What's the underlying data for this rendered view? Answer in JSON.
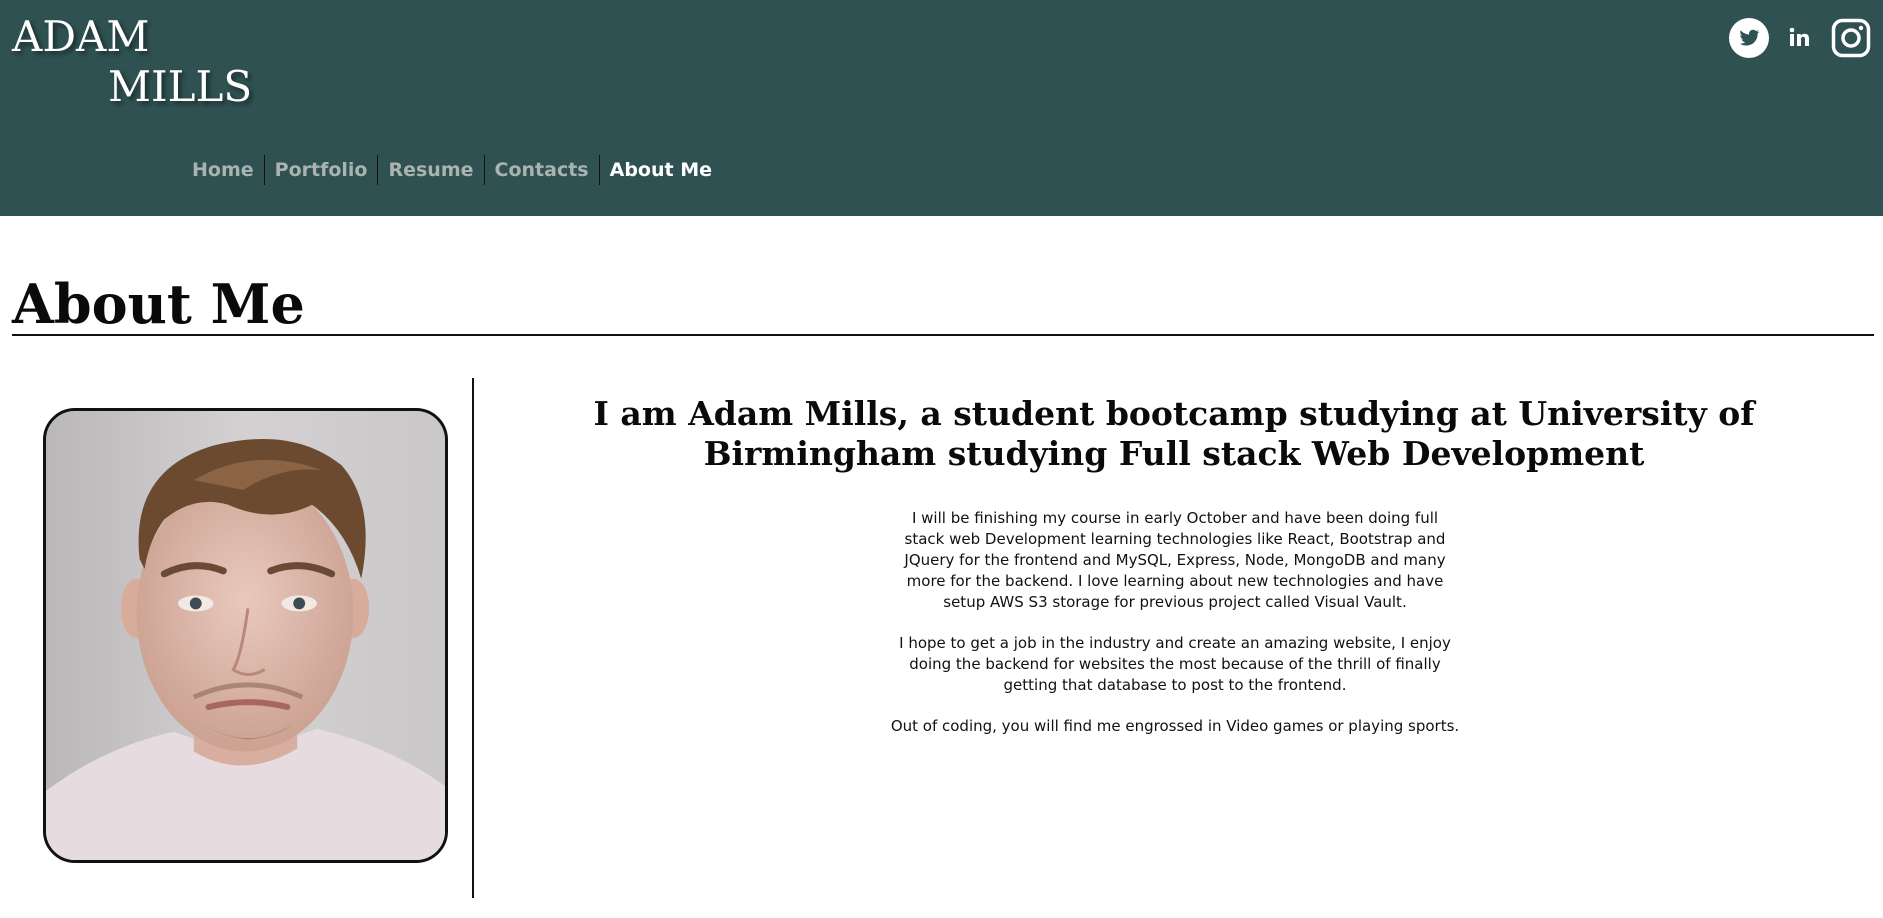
{
  "header": {
    "logo_line1": "ADAM",
    "logo_line2": "MILLS",
    "nav": [
      {
        "label": "Home",
        "active": false
      },
      {
        "label": "Portfolio",
        "active": false
      },
      {
        "label": "Resume",
        "active": false
      },
      {
        "label": "Contacts",
        "active": false
      },
      {
        "label": "About Me",
        "active": true
      }
    ],
    "social_icons": [
      "twitter-icon",
      "linkedin-icon",
      "instagram-icon"
    ]
  },
  "main": {
    "title": "About Me",
    "photo_icon": "profile-photo",
    "intro": "I am Adam Mills, a student bootcamp studying at University of Birmingham studying Full stack Web Development",
    "bio": [
      "I will be finishing my course in early October and have been doing full stack web Development learning technologies like React, Bootstrap and JQuery for the frontend and MySQL, Express, Node, MongoDB and many more for the backend. I love learning about new technologies and have setup AWS S3 storage for previous project called Visual Vault.",
      "I hope to get a job in the industry and create an amazing website, I enjoy doing the backend for websites the most because of the thrill of finally getting that database to post to the frontend.",
      "Out of coding, you will find me engrossed in Video games or playing sports."
    ]
  },
  "colors": {
    "header_bg": "#2f5151",
    "nav_inactive": "#a9b3b1",
    "nav_active": "#ffffff",
    "page_bg": "#ffffff"
  }
}
